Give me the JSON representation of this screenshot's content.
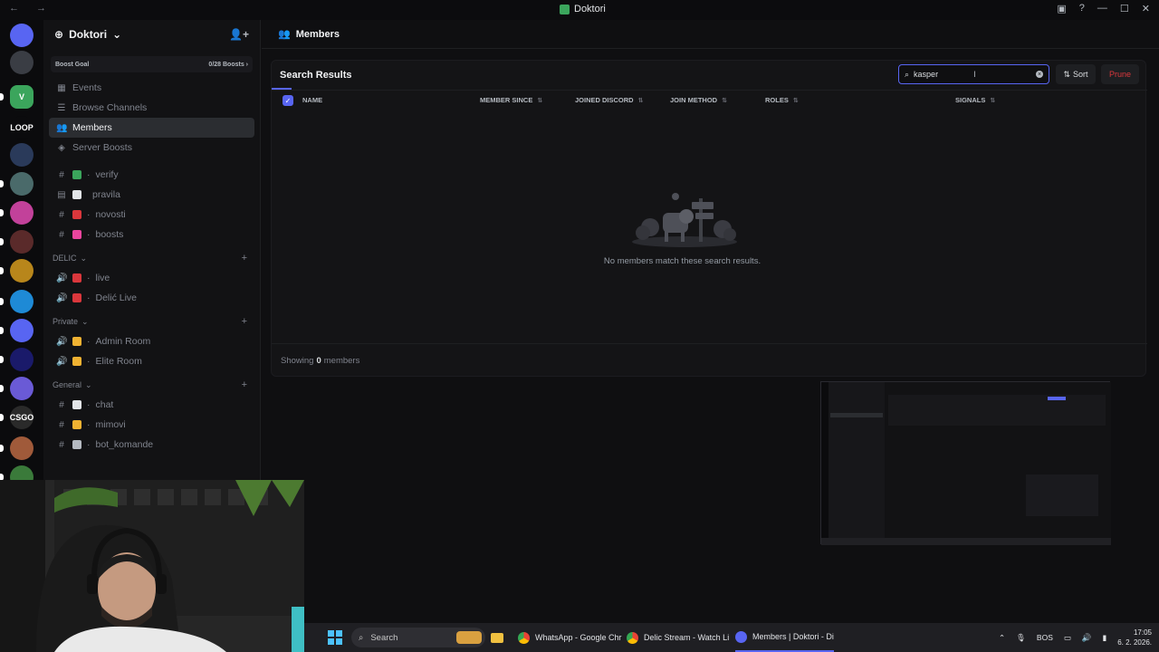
{
  "window": {
    "title": "Doktori",
    "nav_arrows": "←  →"
  },
  "server_list": {
    "items": [
      {
        "name": "discord-home",
        "color": "#5865f2",
        "label": ""
      },
      {
        "name": "server-1",
        "color": "#3a3d44",
        "label": ""
      },
      {
        "name": "server-doktori",
        "color": "#3ba55c",
        "label": "V"
      },
      {
        "name": "server-loop",
        "color": "#0b0b0d",
        "label": "LOOP"
      },
      {
        "name": "server-4",
        "color": "#2a3a5a",
        "label": ""
      },
      {
        "name": "server-5",
        "color": "#4a6a6a",
        "label": ""
      },
      {
        "name": "server-6",
        "color": "#c2419a",
        "label": ""
      },
      {
        "name": "server-7",
        "color": "#5a2a2a",
        "label": ""
      },
      {
        "name": "server-8",
        "color": "#b8861b",
        "label": ""
      },
      {
        "name": "server-9",
        "color": "#1e8ad6",
        "label": ""
      },
      {
        "name": "server-10",
        "color": "#5865f2",
        "label": ""
      },
      {
        "name": "server-11",
        "color": "#1a1a6a",
        "label": ""
      },
      {
        "name": "server-12",
        "color": "#6a5ad6",
        "label": ""
      },
      {
        "name": "server-csgo",
        "color": "#2a2a2a",
        "label": "CSGO"
      },
      {
        "name": "server-14",
        "color": "#a05a3a",
        "label": ""
      },
      {
        "name": "server-15",
        "color": "#3a7a3a",
        "label": ""
      }
    ]
  },
  "guild": {
    "name": "Doktori",
    "boost_goal_label": "Boost Goal",
    "boost_goal_value": "0/28 Boosts",
    "menu": [
      {
        "label": "Events",
        "icon": "calendar-icon",
        "active": false
      },
      {
        "label": "Browse Channels",
        "icon": "browse-icon",
        "active": false
      },
      {
        "label": "Members",
        "icon": "members-icon",
        "active": true
      },
      {
        "label": "Server Boosts",
        "icon": "boost-icon",
        "active": false
      }
    ],
    "top_channels": [
      {
        "label": "verify",
        "prefix": "·",
        "emoji_color": "#3ba55c",
        "icon": "#"
      },
      {
        "label": "pravila",
        "prefix": "",
        "emoji_color": "#e3e5e8",
        "icon": "rules"
      },
      {
        "label": "novosti",
        "prefix": "·",
        "emoji_color": "#da373c",
        "icon": "#"
      },
      {
        "label": "boosts",
        "prefix": "·",
        "emoji_color": "#eb459e",
        "icon": "#"
      }
    ],
    "categories": [
      {
        "name": "DELIC",
        "channels": [
          {
            "label": "live",
            "prefix": "·",
            "emoji_color": "#da373c",
            "icon": "speaker"
          },
          {
            "label": "Delić Live",
            "prefix": "·",
            "emoji_color": "#da373c",
            "icon": "speaker"
          }
        ]
      },
      {
        "name": "Private",
        "channels": [
          {
            "label": "Admin Room",
            "prefix": "·",
            "emoji_color": "#f0b232",
            "icon": "speaker"
          },
          {
            "label": "Elite Room",
            "prefix": "·",
            "emoji_color": "#f0b232",
            "icon": "speaker"
          }
        ]
      },
      {
        "name": "General",
        "channels": [
          {
            "label": "chat",
            "prefix": "·",
            "emoji_color": "#e3e5e8",
            "icon": "#"
          },
          {
            "label": "mimovi",
            "prefix": "·",
            "emoji_color": "#f0b232",
            "icon": "#"
          },
          {
            "label": "bot_komande",
            "prefix": "·",
            "emoji_color": "#b5bac1",
            "icon": "#"
          }
        ]
      }
    ]
  },
  "topbar": {
    "title": "Members"
  },
  "members_panel": {
    "heading": "Search Results",
    "search_value": "kasper",
    "sort_label": "Sort",
    "prune_label": "Prune",
    "columns": [
      "NAME",
      "MEMBER SINCE",
      "JOINED DISCORD",
      "JOIN METHOD",
      "ROLES",
      "SIGNALS"
    ],
    "empty_message": "No members match these search results.",
    "footer_prefix": "Showing",
    "footer_count": "0",
    "footer_suffix": "members"
  },
  "taskbar": {
    "search_label": "Search",
    "apps": [
      {
        "label": "WhatsApp - Google Chr",
        "icon": "chrome-icon"
      },
      {
        "label": "Delic Stream - Watch Li",
        "icon": "chrome-icon"
      },
      {
        "label": "Members | Doktori - Di",
        "icon": "discord-icon"
      }
    ],
    "lang": "BOS",
    "time": "17:05",
    "date": "6. 2. 2026."
  },
  "colors": {
    "accent": "#5865f2",
    "danger": "#da373c",
    "background": "#0f0f11"
  }
}
